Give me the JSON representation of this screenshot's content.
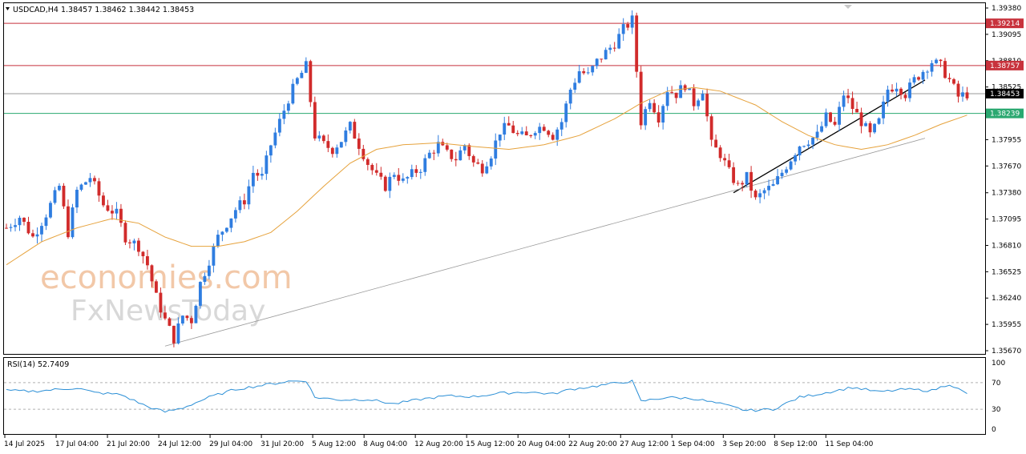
{
  "header": {
    "symbol_line": "USDCAD,H4  1.38457 1.38462 1.38442 1.38453",
    "rsi_line": "RSI(14) 52.7409"
  },
  "watermark": {
    "line1": "economies.com",
    "line2": "FxNewsToday"
  },
  "colors": {
    "bull": "#2f7de0",
    "bear": "#d12b2b",
    "ma": "#e6a23c",
    "resistance": "#c8323c",
    "support": "#2aa870",
    "current": "#9a9a9a",
    "rsi": "#2b8fd6",
    "trendline_main": "#000000",
    "trendline_long": "#9a9a9a"
  },
  "chart_data": {
    "type": "candlestick",
    "symbol": "USDCAD",
    "timeframe": "H4",
    "ylim": [
      1.3567,
      1.3938
    ],
    "price_ticks": [
      "1.39380",
      "1.39095",
      "1.38810",
      "1.38525",
      "1.38240",
      "1.37955",
      "1.37670",
      "1.37380",
      "1.37095",
      "1.36810",
      "1.36525",
      "1.36240",
      "1.35955",
      "1.35670"
    ],
    "levels": [
      {
        "label": "1.39214",
        "value": 1.39214,
        "kind": "resistance"
      },
      {
        "label": "1.38757",
        "value": 1.38757,
        "kind": "resistance"
      },
      {
        "label": "1.38453",
        "value": 1.38453,
        "kind": "current"
      },
      {
        "label": "1.38239",
        "value": 1.38239,
        "kind": "support"
      }
    ],
    "date_labels": [
      "14 Jul 2025",
      "17 Jul 04:00",
      "21 Jul 20:00",
      "24 Jul 12:00",
      "29 Jul 04:00",
      "31 Jul 20:00",
      "5 Aug 12:00",
      "8 Aug 04:00",
      "12 Aug 20:00",
      "15 Aug 12:00",
      "20 Aug 04:00",
      "22 Aug 20:00",
      "27 Aug 12:00",
      "1 Sep 04:00",
      "3 Sep 20:00",
      "8 Sep 12:00",
      "11 Sep 04:00"
    ],
    "close_path": [
      [
        0,
        1.37
      ],
      [
        3,
        1.3712
      ],
      [
        6,
        1.369
      ],
      [
        9,
        1.3715
      ],
      [
        12,
        1.3745
      ],
      [
        14,
        1.3695
      ],
      [
        16,
        1.374
      ],
      [
        19,
        1.3755
      ],
      [
        22,
        1.3725
      ],
      [
        25,
        1.3715
      ],
      [
        27,
        1.369
      ],
      [
        30,
        1.368
      ],
      [
        32,
        1.366
      ],
      [
        34,
        1.3625
      ],
      [
        36,
        1.36
      ],
      [
        38,
        1.358
      ],
      [
        40,
        1.3605
      ],
      [
        42,
        1.36
      ],
      [
        44,
        1.364
      ],
      [
        46,
        1.3665
      ],
      [
        48,
        1.369
      ],
      [
        50,
        1.3705
      ],
      [
        52,
        1.372
      ],
      [
        54,
        1.373
      ],
      [
        56,
        1.376
      ],
      [
        58,
        1.3755
      ],
      [
        60,
        1.379
      ],
      [
        62,
        1.3815
      ],
      [
        64,
        1.384
      ],
      [
        66,
        1.386
      ],
      [
        68,
        1.3875
      ],
      [
        70,
        1.38
      ],
      [
        72,
        1.379
      ],
      [
        74,
        1.3785
      ],
      [
        76,
        1.3795
      ],
      [
        78,
        1.381
      ],
      [
        80,
        1.379
      ],
      [
        82,
        1.377
      ],
      [
        84,
        1.3755
      ],
      [
        86,
        1.3745
      ],
      [
        88,
        1.376
      ],
      [
        90,
        1.375
      ],
      [
        92,
        1.3758
      ],
      [
        94,
        1.3765
      ],
      [
        96,
        1.378
      ],
      [
        98,
        1.379
      ],
      [
        100,
        1.378
      ],
      [
        102,
        1.3775
      ],
      [
        104,
        1.379
      ],
      [
        106,
        1.377
      ],
      [
        108,
        1.3765
      ],
      [
        110,
        1.378
      ],
      [
        112,
        1.3805
      ],
      [
        114,
        1.381
      ],
      [
        116,
        1.38
      ],
      [
        118,
        1.3798
      ],
      [
        120,
        1.3808
      ],
      [
        122,
        1.381
      ],
      [
        124,
        1.38
      ],
      [
        126,
        1.3815
      ],
      [
        128,
        1.385
      ],
      [
        130,
        1.387
      ],
      [
        132,
        1.3865
      ],
      [
        134,
        1.388
      ],
      [
        136,
        1.389
      ],
      [
        138,
        1.39
      ],
      [
        140,
        1.3915
      ],
      [
        142,
        1.3925
      ],
      [
        144,
        1.3815
      ],
      [
        146,
        1.384
      ],
      [
        148,
        1.382
      ],
      [
        150,
        1.385
      ],
      [
        152,
        1.3845
      ],
      [
        154,
        1.3855
      ],
      [
        156,
        1.3835
      ],
      [
        158,
        1.385
      ],
      [
        160,
        1.379
      ],
      [
        162,
        1.378
      ],
      [
        164,
        1.376
      ],
      [
        166,
        1.3745
      ],
      [
        168,
        1.3755
      ],
      [
        170,
        1.373
      ],
      [
        172,
        1.374
      ],
      [
        174,
        1.3745
      ],
      [
        176,
        1.376
      ],
      [
        178,
        1.3775
      ],
      [
        180,
        1.379
      ],
      [
        182,
        1.3795
      ],
      [
        184,
        1.38
      ],
      [
        186,
        1.382
      ],
      [
        188,
        1.381
      ],
      [
        190,
        1.3845
      ],
      [
        192,
        1.383
      ],
      [
        194,
        1.3815
      ],
      [
        196,
        1.38
      ],
      [
        198,
        1.3815
      ],
      [
        200,
        1.385
      ],
      [
        202,
        1.3855
      ],
      [
        204,
        1.3845
      ],
      [
        206,
        1.386
      ],
      [
        208,
        1.387
      ],
      [
        210,
        1.388
      ],
      [
        212,
        1.3875
      ],
      [
        214,
        1.386
      ],
      [
        216,
        1.3842
      ],
      [
        218,
        1.3845
      ]
    ],
    "ma_path": [
      [
        0,
        1.366
      ],
      [
        8,
        1.3685
      ],
      [
        16,
        1.37
      ],
      [
        24,
        1.371
      ],
      [
        30,
        1.3705
      ],
      [
        36,
        1.369
      ],
      [
        42,
        1.368
      ],
      [
        48,
        1.368
      ],
      [
        54,
        1.3685
      ],
      [
        60,
        1.3695
      ],
      [
        66,
        1.3718
      ],
      [
        72,
        1.3745
      ],
      [
        78,
        1.377
      ],
      [
        84,
        1.3785
      ],
      [
        90,
        1.379
      ],
      [
        98,
        1.3792
      ],
      [
        106,
        1.3788
      ],
      [
        114,
        1.3785
      ],
      [
        122,
        1.379
      ],
      [
        130,
        1.38
      ],
      [
        138,
        1.3818
      ],
      [
        144,
        1.3835
      ],
      [
        150,
        1.3848
      ],
      [
        156,
        1.3852
      ],
      [
        162,
        1.3848
      ],
      [
        170,
        1.3833
      ],
      [
        176,
        1.3815
      ],
      [
        182,
        1.38
      ],
      [
        188,
        1.379
      ],
      [
        194,
        1.3785
      ],
      [
        200,
        1.379
      ],
      [
        206,
        1.38
      ],
      [
        212,
        1.3812
      ],
      [
        218,
        1.3822
      ]
    ],
    "trendlines": [
      {
        "name": "",
        "from": [
          165,
          1.3738
        ],
        "to": [
          250,
          1.386
        ]
      },
      {
        "name": "",
        "from": [
          36,
          1.3572
        ],
        "to": [
          235,
          1.3797
        ]
      }
    ],
    "rsi": {
      "label": "RSI(14) 52.7409",
      "value": 52.7409,
      "levels": [
        70,
        30
      ],
      "ticks": [
        "100",
        "70",
        "30",
        "0"
      ],
      "path": [
        [
          0,
          58
        ],
        [
          6,
          57
        ],
        [
          12,
          60
        ],
        [
          16,
          62
        ],
        [
          20,
          55
        ],
        [
          26,
          52
        ],
        [
          32,
          34
        ],
        [
          36,
          26
        ],
        [
          40,
          32
        ],
        [
          46,
          48
        ],
        [
          52,
          60
        ],
        [
          58,
          66
        ],
        [
          64,
          72
        ],
        [
          68,
          73
        ],
        [
          70,
          48
        ],
        [
          76,
          44
        ],
        [
          82,
          45
        ],
        [
          88,
          38
        ],
        [
          94,
          45
        ],
        [
          100,
          50
        ],
        [
          106,
          49
        ],
        [
          112,
          54
        ],
        [
          118,
          56
        ],
        [
          124,
          53
        ],
        [
          128,
          60
        ],
        [
          134,
          65
        ],
        [
          140,
          71
        ],
        [
          142,
          72
        ],
        [
          144,
          42
        ],
        [
          150,
          48
        ],
        [
          156,
          46
        ],
        [
          162,
          38
        ],
        [
          168,
          28
        ],
        [
          174,
          30
        ],
        [
          180,
          48
        ],
        [
          186,
          55
        ],
        [
          192,
          63
        ],
        [
          198,
          56
        ],
        [
          204,
          60
        ],
        [
          210,
          58
        ],
        [
          214,
          68
        ],
        [
          218,
          52.7
        ]
      ]
    }
  }
}
